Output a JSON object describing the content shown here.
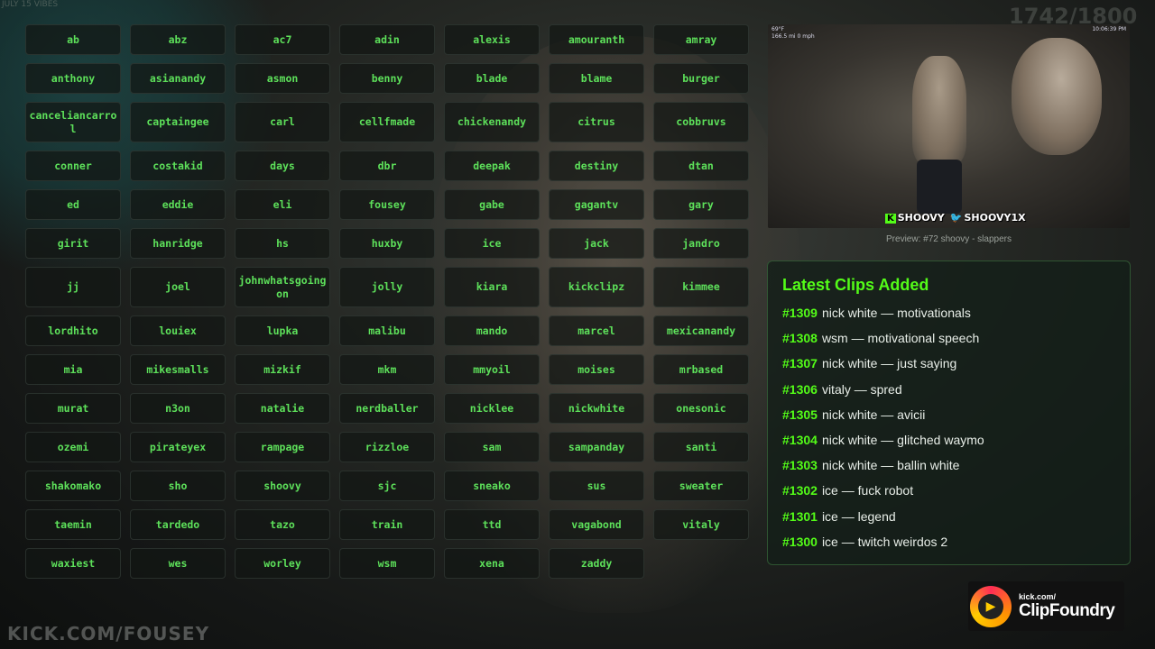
{
  "background": {
    "top_left_text": "JULY 15 VIBES",
    "counter": "1742/1800"
  },
  "grid_rows": [
    [
      "ab",
      "abz",
      "ac7",
      "adin",
      "alexis",
      "amouranth",
      "amray"
    ],
    [
      "anthony",
      "asianandy",
      "asmon",
      "benny",
      "blade",
      "blame",
      "burger"
    ],
    [
      "canceliancarrol",
      "captaingee",
      "carl",
      "cellfmade",
      "chickenandy",
      "citrus",
      "cobbruvs"
    ],
    [
      "conner",
      "costakid",
      "days",
      "dbr",
      "deepak",
      "destiny",
      "dtan"
    ],
    [
      "ed",
      "eddie",
      "eli",
      "fousey",
      "gabe",
      "gagantv",
      "gary"
    ],
    [
      "girit",
      "hanridge",
      "hs",
      "huxby",
      "ice",
      "jack",
      "jandro"
    ],
    [
      "jj",
      "joel",
      "johnwhatsgoingon",
      "jolly",
      "kiara",
      "kickclipz",
      "kimmee"
    ],
    [
      "lordhito",
      "louiex",
      "lupka",
      "malibu",
      "mando",
      "marcel",
      "mexicanandy"
    ],
    [
      "mia",
      "mikesmalls",
      "mizkif",
      "mkm",
      "mmyoil",
      "moises",
      "mrbased"
    ],
    [
      "murat",
      "n3on",
      "natalie",
      "nerdballer",
      "nicklee",
      "nickwhite",
      "onesonic"
    ],
    [
      "ozemi",
      "pirateyex",
      "rampage",
      "rizzloe",
      "sam",
      "sampanday",
      "santi"
    ],
    [
      "shakomako",
      "sho",
      "shoovy",
      "sjc",
      "sneako",
      "sus",
      "sweater"
    ],
    [
      "taemin",
      "tardedo",
      "tazo",
      "train",
      "ttd",
      "vagabond",
      "vitaly"
    ],
    [
      "waxiest",
      "wes",
      "worley",
      "wsm",
      "xena",
      "zaddy"
    ]
  ],
  "preview": {
    "overlay_left_1": "69°F",
    "overlay_left_2": "166.5 mi  0 mph",
    "overlay_right": "10:06:39 PM",
    "tag_kick": "SHOOVY",
    "tag_twitter": "SHOOVY1X",
    "caption": "Preview: #72 shoovy - slappers"
  },
  "clips": {
    "title": "Latest Clips Added",
    "items": [
      {
        "num": "#1309",
        "text": "nick white — motivationals"
      },
      {
        "num": "#1308",
        "text": "wsm — motivational speech"
      },
      {
        "num": "#1307",
        "text": "nick white — just saying"
      },
      {
        "num": "#1306",
        "text": "vitaly — spred"
      },
      {
        "num": "#1305",
        "text": "nick white — avicii"
      },
      {
        "num": "#1304",
        "text": "nick white — glitched waymo"
      },
      {
        "num": "#1303",
        "text": "nick white — ballin white"
      },
      {
        "num": "#1302",
        "text": "ice — fuck robot"
      },
      {
        "num": "#1301",
        "text": "ice — legend"
      },
      {
        "num": "#1300",
        "text": "ice — twitch weirdos 2"
      }
    ]
  },
  "logo": {
    "small": "kick.com/",
    "big": "ClipFoundry"
  },
  "watermark": "KICK.COM/FOUSEY",
  "colors": {
    "accent": "#53fc18",
    "cell_text": "#5de05a"
  }
}
